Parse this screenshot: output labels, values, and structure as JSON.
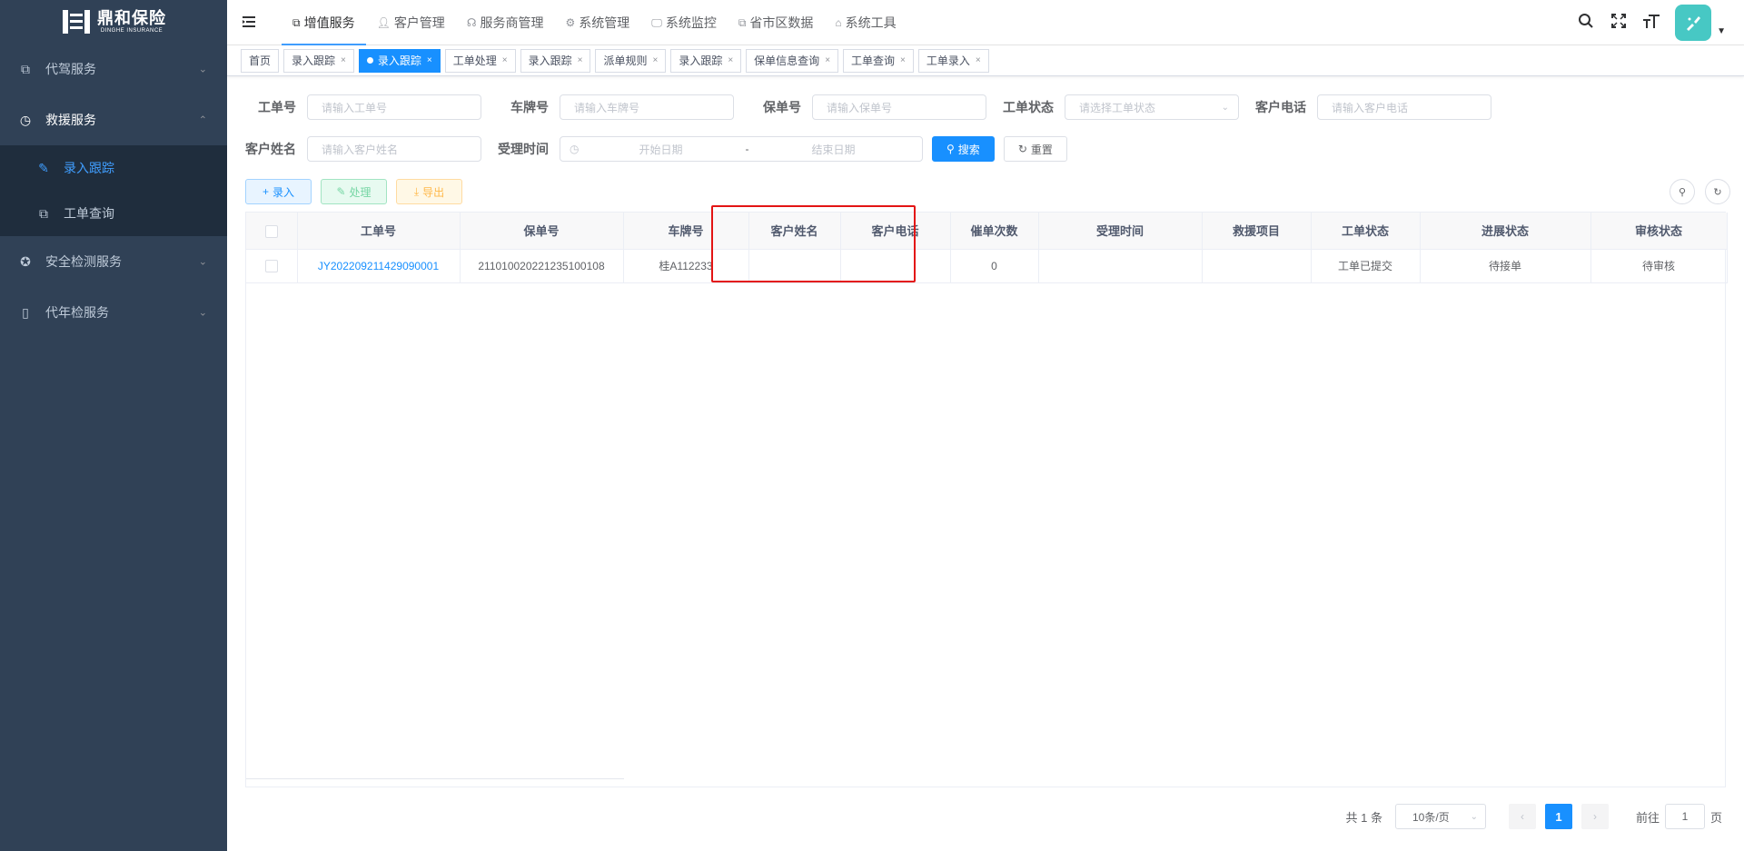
{
  "brand": {
    "name_cn": "鼎和保险",
    "name_en": "DINGHE INSURANCE"
  },
  "sidebar": {
    "items": [
      {
        "label": "代驾服务",
        "icon": "document-copy-icon",
        "arrow": "chevron-down-icon"
      },
      {
        "label": "救援服务",
        "icon": "clock-icon",
        "arrow": "chevron-up-icon"
      },
      {
        "label": "安全检测服务",
        "icon": "cog-icon",
        "arrow": "chevron-down-icon"
      },
      {
        "label": "代年检服务",
        "icon": "book-icon",
        "arrow": "chevron-down-icon"
      }
    ],
    "sub_items": [
      {
        "label": "录入跟踪",
        "active": true
      },
      {
        "label": "工单查询",
        "active": false
      }
    ]
  },
  "top_nav": {
    "items": [
      {
        "label": "增值服务",
        "active": true
      },
      {
        "label": "客户管理"
      },
      {
        "label": "服务商管理"
      },
      {
        "label": "系统管理"
      },
      {
        "label": "系统监控"
      },
      {
        "label": "省市区数据"
      },
      {
        "label": "系统工具"
      }
    ]
  },
  "tags": [
    {
      "label": "首页",
      "closable": false
    },
    {
      "label": "录入跟踪",
      "closable": true
    },
    {
      "label": "录入跟踪",
      "closable": true,
      "active": true
    },
    {
      "label": "工单处理",
      "closable": true
    },
    {
      "label": "录入跟踪",
      "closable": true
    },
    {
      "label": "派单规则",
      "closable": true
    },
    {
      "label": "录入跟踪",
      "closable": true
    },
    {
      "label": "保单信息查询",
      "closable": true
    },
    {
      "label": "工单查询",
      "closable": true
    },
    {
      "label": "工单录入",
      "closable": true
    }
  ],
  "close_glyph": "×",
  "search_form": {
    "order_no": {
      "label": "工单号",
      "placeholder": "请输入工单号"
    },
    "plate_no": {
      "label": "车牌号",
      "placeholder": "请输入车牌号"
    },
    "policy_no": {
      "label": "保单号",
      "placeholder": "请输入保单号"
    },
    "order_status": {
      "label": "工单状态",
      "placeholder": "请选择工单状态"
    },
    "customer_phone": {
      "label": "客户电话",
      "placeholder": "请输入客户电话"
    },
    "customer_name": {
      "label": "客户姓名",
      "placeholder": "请输入客户姓名"
    },
    "accept_time": {
      "label": "受理时间",
      "start_placeholder": "开始日期",
      "separator": "-",
      "end_placeholder": "结束日期"
    },
    "search_button": "搜索",
    "reset_button": "重置"
  },
  "toolbar": {
    "add_label": "录入",
    "process_label": "处理",
    "export_label": "导出"
  },
  "table": {
    "columns": [
      "工单号",
      "保单号",
      "车牌号",
      "客户姓名",
      "客户电话",
      "催单次数",
      "受理时间",
      "救援项目",
      "工单状态",
      "进展状态",
      "审核状态"
    ],
    "rows": [
      [
        "JY202209211429090001",
        "211010020221235100108",
        "桂A112233",
        "",
        "",
        "0",
        "",
        "",
        "工单已提交",
        "待接单",
        "待审核"
      ]
    ]
  },
  "pagination": {
    "total_text": "共 1 条",
    "page_size": "10条/页",
    "current_page": "1",
    "goto_label": "前往",
    "goto_value": "1",
    "page_unit": "页"
  }
}
